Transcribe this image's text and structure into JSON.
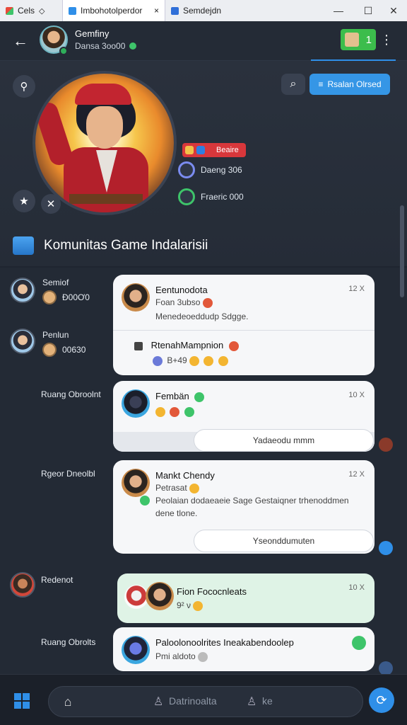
{
  "browser": {
    "tabs": [
      {
        "label": "Cels",
        "active": false
      },
      {
        "label": "Imbohotolperdor",
        "active": true
      },
      {
        "label": "Semdejdn",
        "active": false
      }
    ],
    "tab_close": "×",
    "controls": {
      "minimize": "—",
      "maximize": "☐",
      "close": "✕"
    }
  },
  "header": {
    "back_icon": "arrow-left-icon",
    "name": "Gemfiny",
    "subtitle": "Dansa 3oo00",
    "badge_count": "1",
    "more_icon": "dots-icon"
  },
  "hero": {
    "cta_label": "Rsalan Olrsed",
    "live_label": "Beaire",
    "stats": [
      {
        "label": "Daeng 306"
      },
      {
        "label": "Fraeric 000"
      }
    ],
    "section_title": "Komunitas Game Indalarisii"
  },
  "sidebar": [
    {
      "name": "Semiof",
      "sub": "Đ00Ơ0"
    },
    {
      "name": "Penlun",
      "sub": "00630"
    },
    {
      "label": "Ruang Obroolnt"
    },
    {
      "label": "Rgeor Dneolbl"
    },
    {
      "label": "Redenot"
    },
    {
      "label": "Ruang Obrolts"
    }
  ],
  "cards": [
    {
      "name": "Eentunodota",
      "time": "12 X",
      "line1": "Foan 3ubso",
      "line2": "Menedeoeddudp Sdgge.",
      "sub_name": "RtenahMampnion",
      "sub_line": "B+49"
    },
    {
      "name": "Fembän",
      "time": "10 X",
      "pill": "Yadaeodu mmm"
    },
    {
      "name": "Mankt Chendy",
      "time": "12 X",
      "line1": "Petrasat",
      "line2": "Peolaian dodaeaeie Sage Gestaiqner trhenoddmen",
      "line3": "dene tlone.",
      "pill": "Yseonddumuten"
    },
    {
      "name": "Fion Fococnleats",
      "time": "10 X",
      "line1": "9² ν"
    },
    {
      "name": "Paloolonoolrites Ineakabendoolep",
      "line1": "Pmi aldoto"
    }
  ],
  "taskbar": {
    "search_placeholder": "Datrinoalta",
    "search_extra": "ke"
  },
  "colors": {
    "accent": "#2f8fe8",
    "success": "#3ec46a",
    "live": "#d8373b",
    "background": "#1f2530"
  }
}
